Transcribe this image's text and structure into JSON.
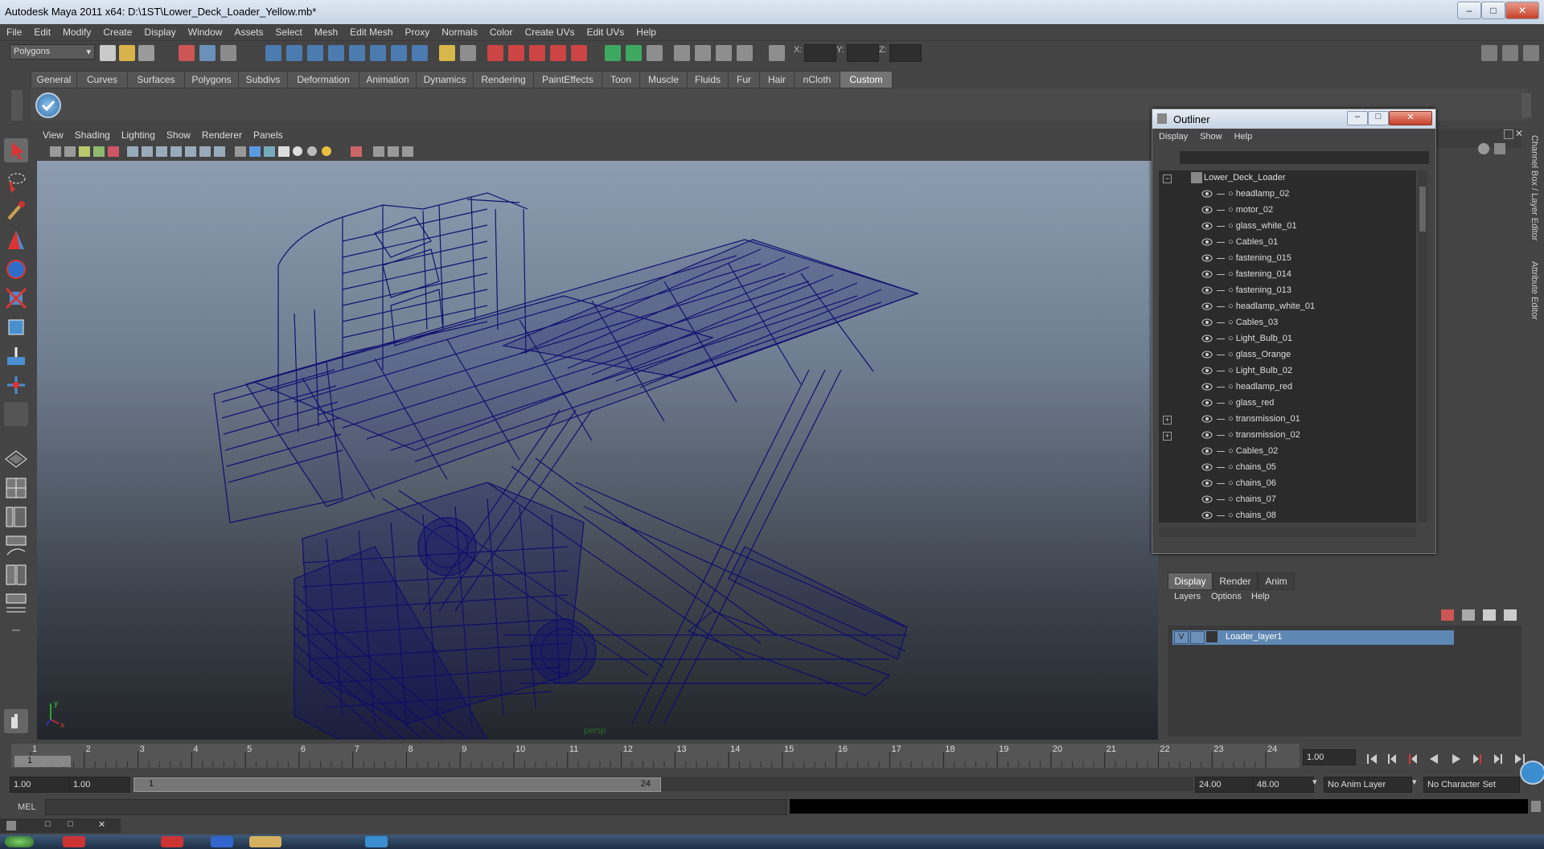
{
  "window": {
    "title": "Autodesk Maya 2011 x64: D:\\1ST\\Lower_Deck_Loader_Yellow.mb*"
  },
  "menubar": [
    "File",
    "Edit",
    "Modify",
    "Create",
    "Display",
    "Window",
    "Assets",
    "Select",
    "Mesh",
    "Edit Mesh",
    "Proxy",
    "Normals",
    "Color",
    "Create UVs",
    "Edit UVs",
    "Help"
  ],
  "status": {
    "mode": "Polygons",
    "x_label": "X:",
    "y_label": "Y:",
    "z_label": "Z:"
  },
  "shelf_tabs": [
    "General",
    "Curves",
    "Surfaces",
    "Polygons",
    "Subdivs",
    "Deformation",
    "Animation",
    "Dynamics",
    "Rendering",
    "PaintEffects",
    "Toon",
    "Muscle",
    "Fluids",
    "Fur",
    "Hair",
    "nCloth",
    "Custom"
  ],
  "shelf_active": "Custom",
  "viewport": {
    "menu": [
      "View",
      "Shading",
      "Lighting",
      "Show",
      "Renderer",
      "Panels"
    ],
    "camera_label": "persp"
  },
  "outliner": {
    "title": "Outliner",
    "menu": [
      "Display",
      "Show",
      "Help"
    ],
    "root": "Lower_Deck_Loader",
    "items": [
      "headlamp_02",
      "motor_02",
      "glass_white_01",
      "Cables_01",
      "fastening_015",
      "fastening_014",
      "fastening_013",
      "headlamp_white_01",
      "Cables_03",
      "Light_Bulb_01",
      "glass_Orange",
      "Light_Bulb_02",
      "headlamp_red",
      "glass_red",
      "transmission_01",
      "transmission_02",
      "Cables_02",
      "chains_05",
      "chains_06",
      "chains_07",
      "chains_08"
    ]
  },
  "layer_editor": {
    "tabs": [
      "Display",
      "Render",
      "Anim"
    ],
    "menu": [
      "Layers",
      "Options",
      "Help"
    ],
    "layer": {
      "visible": "V",
      "name": "Loader_layer1"
    }
  },
  "side_tabs": [
    "Channel Box / Layer Editor",
    "Attribute Editor"
  ],
  "timeline": {
    "ticks": [
      "1",
      "2",
      "3",
      "4",
      "5",
      "6",
      "7",
      "8",
      "9",
      "10",
      "11",
      "12",
      "13",
      "14",
      "15",
      "16",
      "17",
      "18",
      "19",
      "20",
      "21",
      "22",
      "23",
      "24"
    ],
    "current_frame": "1",
    "current_time_field": "1.00"
  },
  "range": {
    "start": "1.00",
    "start2": "1.00",
    "slider_start": "1",
    "slider_end": "24",
    "end": "24.00",
    "end2": "48.00",
    "anim_layer": "No Anim Layer",
    "char_set": "No Character Set"
  },
  "command": {
    "label": "MEL"
  },
  "colors": {
    "wireframe": "#0c0c6e",
    "selection": "#5f87b3"
  }
}
